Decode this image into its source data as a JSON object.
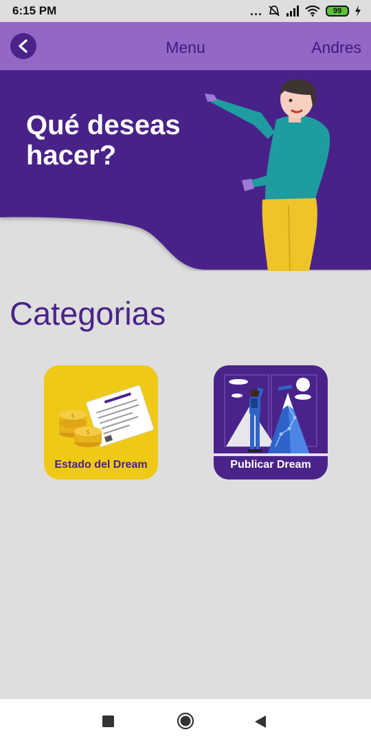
{
  "status_bar": {
    "time": "6:15 PM",
    "dots": "...",
    "battery": "99",
    "icons": [
      "mute-icon",
      "signal-icon",
      "wifi-icon",
      "battery-icon",
      "charging-icon"
    ]
  },
  "app_bar": {
    "back_icon": "chevron-left-icon",
    "title": "Menu",
    "user": "Andres"
  },
  "banner": {
    "title": "Qué deseas hacer?"
  },
  "categories": {
    "heading": "Categorias",
    "items": [
      {
        "label": "Estado del Dream",
        "icon": "coins-receipt-icon"
      },
      {
        "label": "Publicar Dream",
        "icon": "mountain-climber-icon"
      }
    ]
  },
  "nav_bar": {
    "icons": [
      "recents-square-icon",
      "home-circle-icon",
      "back-triangle-icon"
    ]
  },
  "colors": {
    "primary": "#4a2389",
    "app_bar": "#9367c6",
    "background": "#dedede",
    "tile_yellow": "#eec916"
  }
}
